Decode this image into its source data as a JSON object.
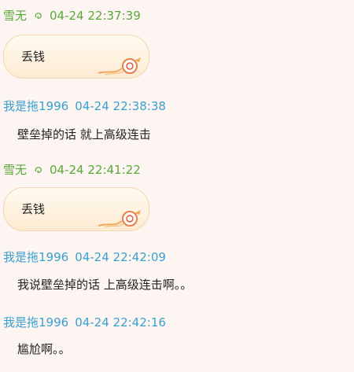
{
  "messages": [
    {
      "sender": "雪无",
      "time": "04-24 22:37:39",
      "text": "丢钱",
      "style": "bubble",
      "role": "other"
    },
    {
      "sender": "我是拖1996",
      "time": "04-24 22:38:38",
      "text": "壁垒掉的话 就上高级连击",
      "style": "plain",
      "role": "me"
    },
    {
      "sender": "雪无",
      "time": "04-24 22:41:22",
      "text": "丢钱",
      "style": "bubble",
      "role": "other"
    },
    {
      "sender": "我是拖1996",
      "time": "04-24 22:42:09",
      "text": "我说壁垒掉的话 上高级连击啊。。",
      "style": "plain",
      "role": "me"
    },
    {
      "sender": "我是拖1996",
      "time": "04-24 22:42:16",
      "text": "尴尬啊。。",
      "style": "plain",
      "role": "me"
    }
  ],
  "colors": {
    "background": "#fcf5f2",
    "self_name": "#3aa0d0",
    "other_name": "#5aa83a",
    "bubble_fill": "#fdebd2",
    "bubble_border": "#f4d6b0"
  },
  "icons": {
    "sender_badge": "swirl-icon",
    "bubble_decoration": "ribbon-decoration-icon"
  }
}
